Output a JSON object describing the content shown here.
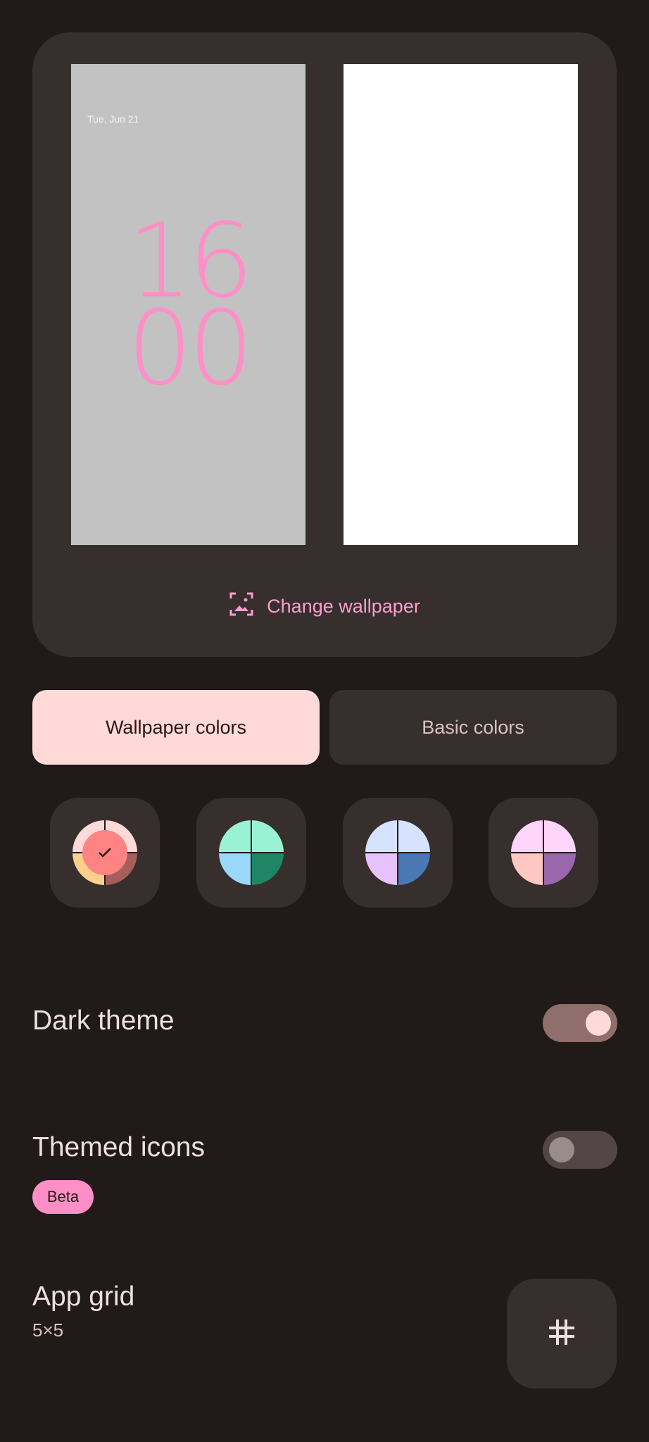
{
  "preview": {
    "lock_date": "Tue, Jun 21",
    "clock_hour": "16",
    "clock_minute": "00"
  },
  "change_wallpaper": {
    "label": "Change wallpaper",
    "icon": "wallpaper-icon"
  },
  "tabs": [
    {
      "label": "Wallpaper colors",
      "selected": true
    },
    {
      "label": "Basic colors",
      "selected": false
    }
  ],
  "swatches": [
    {
      "selected": true,
      "colors": [
        "#ffdad8",
        "#ffdad8",
        "#ffd08c",
        "#a65e5c"
      ]
    },
    {
      "selected": false,
      "colors": [
        "#9af2d4",
        "#9af2d4",
        "#9ad9fa",
        "#1f8565"
      ]
    },
    {
      "selected": false,
      "colors": [
        "#d5e3ff",
        "#d5e3ff",
        "#e6c2ff",
        "#4a78b5"
      ]
    },
    {
      "selected": false,
      "colors": [
        "#ffd5fb",
        "#ffd5fb",
        "#ffc7c2",
        "#9867ac"
      ]
    }
  ],
  "dark_theme": {
    "label": "Dark theme",
    "enabled": true
  },
  "themed_icons": {
    "label": "Themed icons",
    "badge": "Beta",
    "enabled": false
  },
  "app_grid": {
    "label": "App grid",
    "value": "5×5",
    "icon": "grid-icon"
  },
  "colors": {
    "background": "#201a19",
    "surface": "#372f2e",
    "accent_pink": "#ff8fc6",
    "tab_selected": "#ffdad8"
  }
}
